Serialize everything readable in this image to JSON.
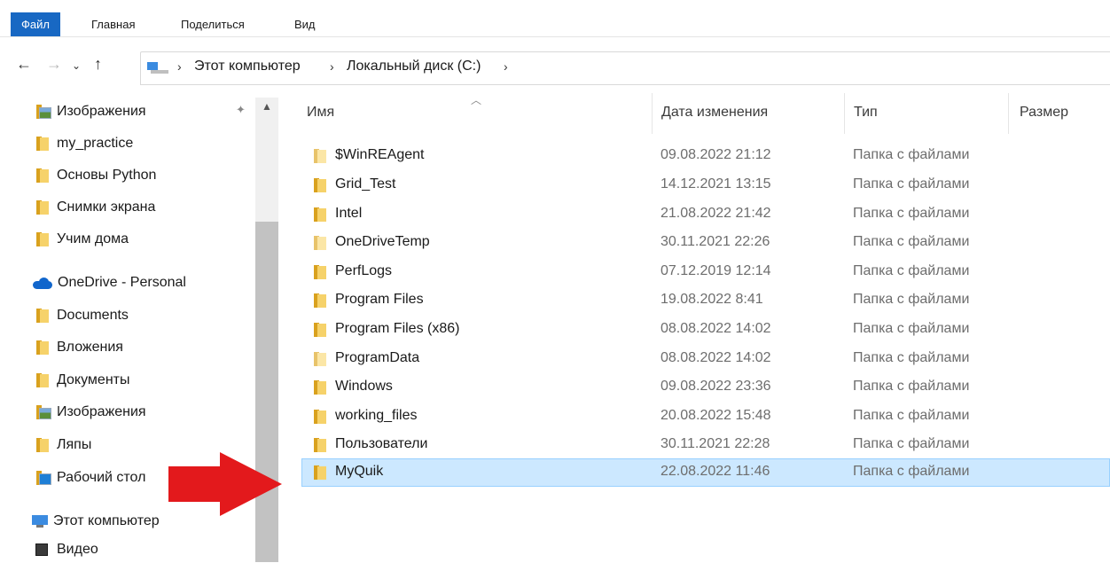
{
  "ribbon": {
    "tabs": [
      {
        "label": "Файл",
        "active": true
      },
      {
        "label": "Главная"
      },
      {
        "label": "Поделиться"
      },
      {
        "label": "Вид"
      }
    ]
  },
  "address": {
    "crumbs": [
      "Этот компьютер",
      "Локальный диск (C:)"
    ]
  },
  "sidebar": {
    "items": [
      {
        "label": "Изображения",
        "icon": "pictures-folder-icon"
      },
      {
        "label": "my_practice",
        "icon": "folder-icon"
      },
      {
        "label": "Основы Python",
        "icon": "folder-icon"
      },
      {
        "label": "Снимки экрана",
        "icon": "folder-icon"
      },
      {
        "label": "Учим дома",
        "icon": "folder-icon"
      },
      {
        "label": "OneDrive - Personal",
        "icon": "onedrive-cloud-icon"
      },
      {
        "label": "Documents",
        "icon": "folder-icon"
      },
      {
        "label": "Вложения",
        "icon": "folder-icon"
      },
      {
        "label": "Документы",
        "icon": "folder-icon"
      },
      {
        "label": "Изображения",
        "icon": "pictures-folder-icon"
      },
      {
        "label": "Ляпы",
        "icon": "folder-icon"
      },
      {
        "label": "Рабочий стол",
        "icon": "desktop-folder-icon"
      },
      {
        "label": "Этот компьютер",
        "icon": "this-pc-icon"
      },
      {
        "label": "Видео",
        "icon": "video-folder-icon"
      }
    ]
  },
  "columns": {
    "name": "Имя",
    "date": "Дата изменения",
    "type": "Тип",
    "size": "Размер"
  },
  "files": [
    {
      "name": "$WinREAgent",
      "date": "09.08.2022 21:12",
      "type": "Папка с файлами"
    },
    {
      "name": "Grid_Test",
      "date": "14.12.2021 13:15",
      "type": "Папка с файлами"
    },
    {
      "name": "Intel",
      "date": "21.08.2022 21:42",
      "type": "Папка с файлами"
    },
    {
      "name": "OneDriveTemp",
      "date": "30.11.2021 22:26",
      "type": "Папка с файлами"
    },
    {
      "name": "PerfLogs",
      "date": "07.12.2019 12:14",
      "type": "Папка с файлами"
    },
    {
      "name": "Program Files",
      "date": "19.08.2022 8:41",
      "type": "Папка с файлами"
    },
    {
      "name": "Program Files (x86)",
      "date": "08.08.2022 14:02",
      "type": "Папка с файлами"
    },
    {
      "name": "ProgramData",
      "date": "08.08.2022 14:02",
      "type": "Папка с файлами"
    },
    {
      "name": "Windows",
      "date": "09.08.2022 23:36",
      "type": "Папка с файлами"
    },
    {
      "name": "working_files",
      "date": "20.08.2022 15:48",
      "type": "Папка с файлами"
    },
    {
      "name": "Пользователи",
      "date": "30.11.2021 22:28",
      "type": "Папка с файлами"
    },
    {
      "name": "MyQuik",
      "date": "22.08.2022 11:46",
      "type": "Папка с файлами",
      "selected": true
    }
  ],
  "colors": {
    "accent": "#1868c3",
    "selection": "#cce8ff",
    "annotation_arrow": "#e3191c"
  }
}
